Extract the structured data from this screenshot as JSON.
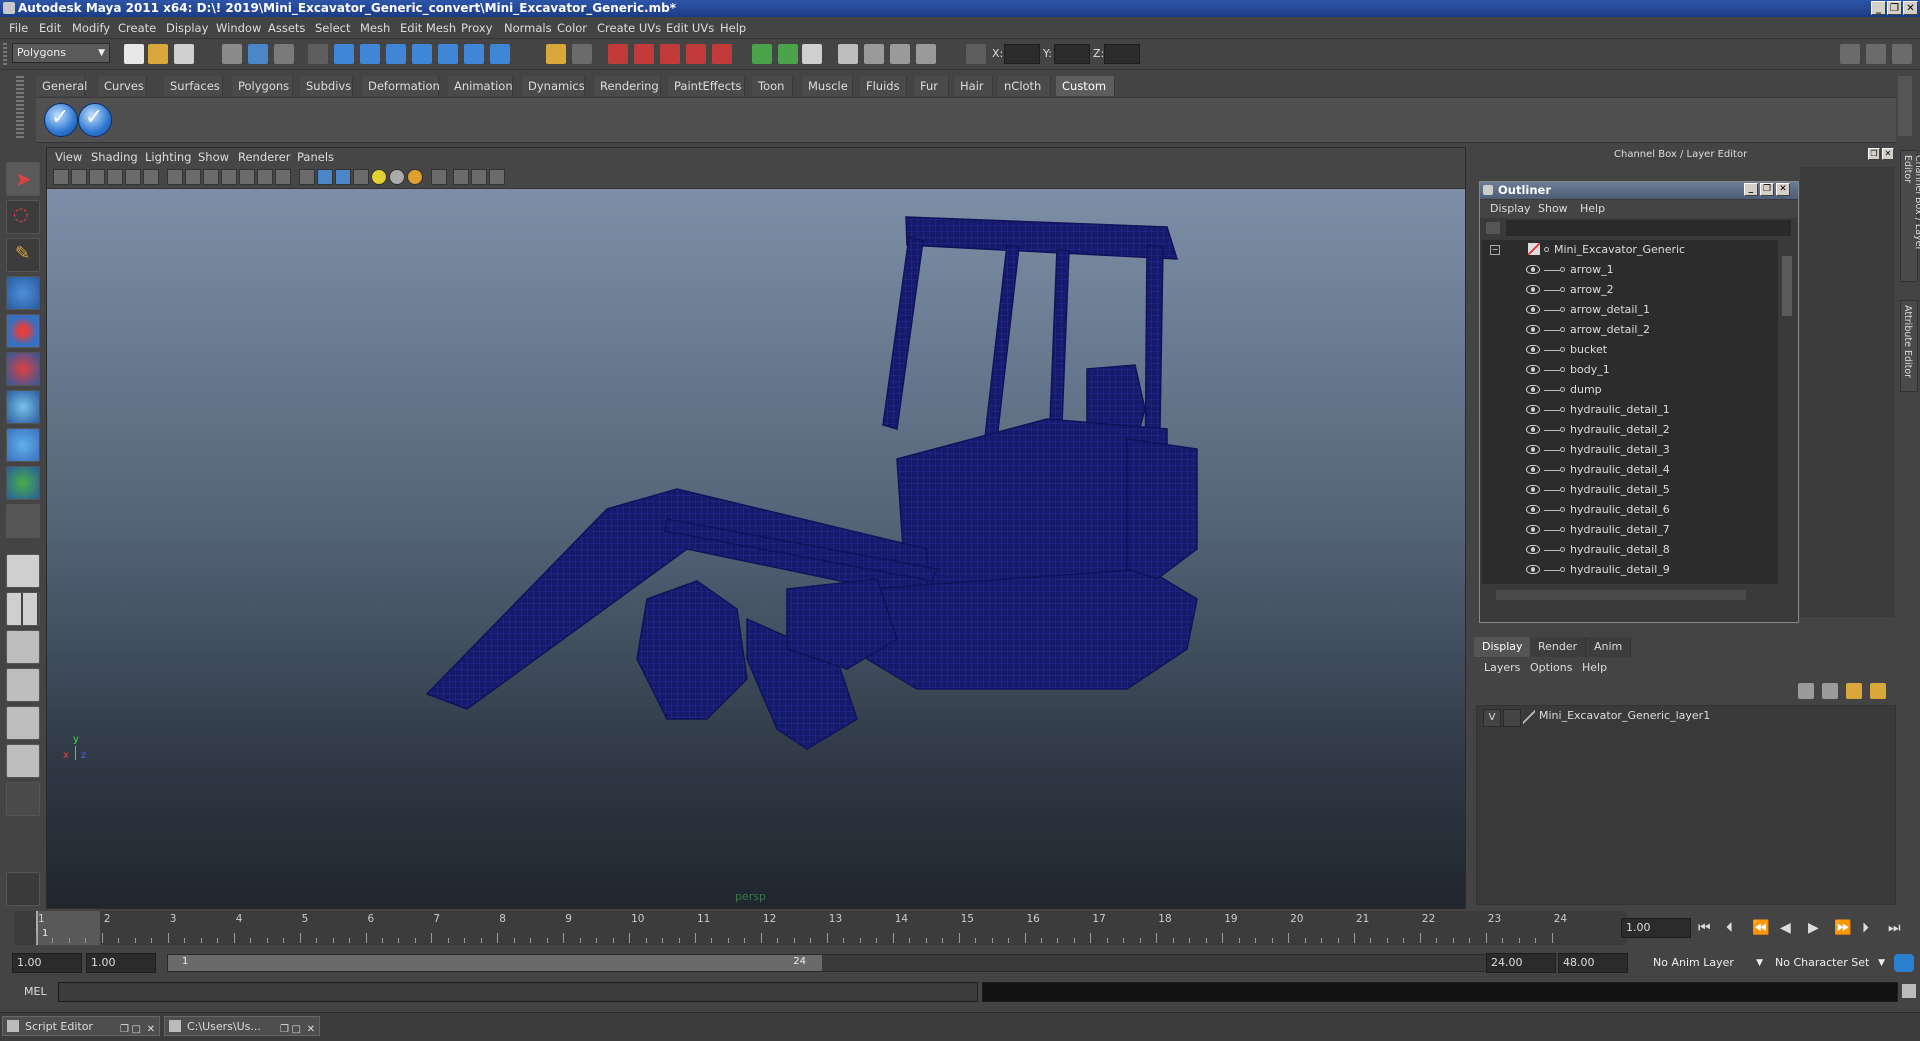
{
  "window": {
    "title": "Autodesk Maya 2011 x64: D:\\! 2019\\Mini_Excavator_Generic_convert\\Mini_Excavator_Generic.mb*"
  },
  "menubar": [
    "File",
    "Edit",
    "Modify",
    "Create",
    "Display",
    "Window",
    "Assets",
    "Select",
    "Mesh",
    "Edit Mesh",
    "Proxy",
    "Normals",
    "Color",
    "Create UVs",
    "Edit UVs",
    "Help"
  ],
  "status_line": {
    "mode": "Polygons",
    "x_label": "X:",
    "y_label": "Y:",
    "z_label": "Z:"
  },
  "shelf_tabs": [
    "General",
    "Curves",
    "Surfaces",
    "Polygons",
    "Subdivs",
    "Deformation",
    "Animation",
    "Dynamics",
    "Rendering",
    "PaintEffects",
    "Toon",
    "Muscle",
    "Fluids",
    "Fur",
    "Hair",
    "nCloth",
    "Custom"
  ],
  "shelf_active_tab": "Custom",
  "viewport": {
    "menu": [
      "View",
      "Shading",
      "Lighting",
      "Show",
      "Renderer",
      "Panels"
    ],
    "camera_label": "persp",
    "axis_x": "x",
    "axis_y": "y",
    "axis_z": "z",
    "wire_color": "#1a1f7a"
  },
  "right_panel": {
    "header": "Channel Box / Layer Editor",
    "side_tabs": [
      "Channel Box / Layer Editor",
      "Attribute Editor"
    ]
  },
  "outliner": {
    "title": "Outliner",
    "menu": [
      "Display",
      "Show",
      "Help"
    ],
    "root": "Mini_Excavator_Generic",
    "items": [
      "arrow_1",
      "arrow_2",
      "arrow_detail_1",
      "arrow_detail_2",
      "bucket",
      "body_1",
      "dump",
      "hydraulic_detail_1",
      "hydraulic_detail_2",
      "hydraulic_detail_3",
      "hydraulic_detail_4",
      "hydraulic_detail_5",
      "hydraulic_detail_6",
      "hydraulic_detail_7",
      "hydraulic_detail_8",
      "hydraulic_detail_9"
    ]
  },
  "layer_editor": {
    "tabs": [
      "Display",
      "Render",
      "Anim"
    ],
    "active_tab": "Display",
    "menu": [
      "Layers",
      "Options",
      "Help"
    ],
    "layers": [
      {
        "visible": "V",
        "name": "Mini_Excavator_Generic_layer1"
      }
    ]
  },
  "timeline": {
    "ticks": [
      "1",
      "2",
      "3",
      "4",
      "5",
      "6",
      "7",
      "8",
      "9",
      "10",
      "11",
      "12",
      "13",
      "14",
      "15",
      "16",
      "17",
      "18",
      "19",
      "20",
      "21",
      "22",
      "23",
      "24"
    ],
    "current_frame_marker": "1",
    "current_time": "1.00"
  },
  "range": {
    "start_time": "1.00",
    "playback_start": "1.00",
    "slider_start": "1",
    "slider_end": "24",
    "playback_end": "24.00",
    "end_time": "48.00",
    "anim_layer": "No Anim Layer",
    "character_set": "No Character Set"
  },
  "command_line": {
    "label": "MEL"
  },
  "taskbar": [
    {
      "label": "Script Editor"
    },
    {
      "label": "C:\\Users\\Us..."
    }
  ]
}
